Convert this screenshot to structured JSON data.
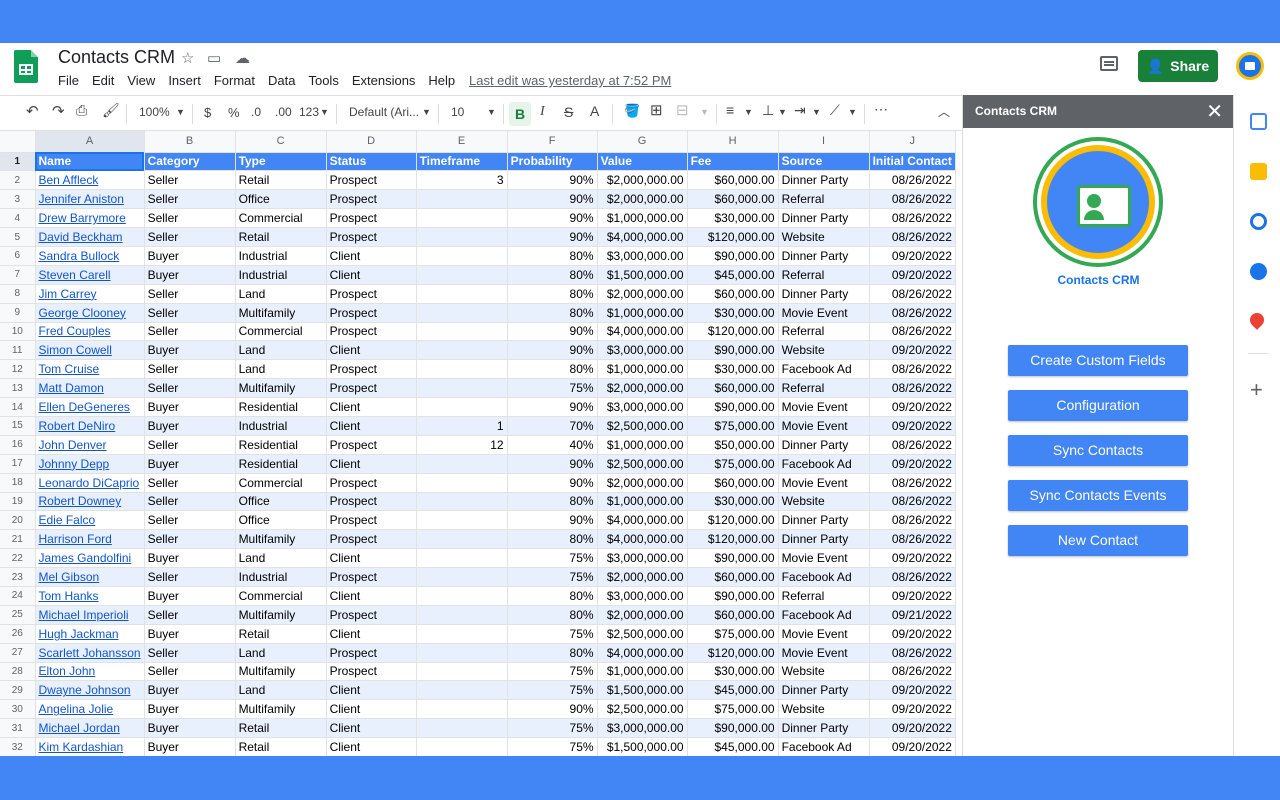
{
  "header": {
    "title": "Contacts CRM",
    "menu": [
      "File",
      "Edit",
      "View",
      "Insert",
      "Format",
      "Data",
      "Tools",
      "Extensions",
      "Help"
    ],
    "last_edit": "Last edit was yesterday at 7:52 PM",
    "share_label": "Share"
  },
  "toolbar": {
    "zoom": "100%",
    "currency": "$",
    "percent": "%",
    "dec_decrease": ".0",
    "dec_increase": ".00",
    "number_format": "123",
    "font": "Default (Ari...",
    "font_size": "10",
    "bold": "B",
    "italic": "I",
    "strike": "S",
    "text_color": "A"
  },
  "grid": {
    "columns": [
      "A",
      "B",
      "C",
      "D",
      "E",
      "F",
      "G",
      "H",
      "I",
      "J"
    ],
    "headers": [
      "Name",
      "Category",
      "Type",
      "Status",
      "Timeframe",
      "Probability",
      "Value",
      "Fee",
      "Source",
      "Initial Contact"
    ],
    "rows": [
      [
        "Ben Affleck",
        "Seller",
        "Retail",
        "Prospect",
        "3",
        "90%",
        "$2,000,000.00",
        "$60,000.00",
        "Dinner Party",
        "08/26/2022"
      ],
      [
        "Jennifer Aniston",
        "Seller",
        "Office",
        "Prospect",
        "",
        "90%",
        "$2,000,000.00",
        "$60,000.00",
        "Referral",
        "08/26/2022"
      ],
      [
        "Drew Barrymore",
        "Seller",
        "Commercial",
        "Prospect",
        "",
        "90%",
        "$1,000,000.00",
        "$30,000.00",
        "Dinner Party",
        "08/26/2022"
      ],
      [
        "David Beckham",
        "Seller",
        "Retail",
        "Prospect",
        "",
        "90%",
        "$4,000,000.00",
        "$120,000.00",
        "Website",
        "08/26/2022"
      ],
      [
        "Sandra Bullock",
        "Buyer",
        "Industrial",
        "Client",
        "",
        "80%",
        "$3,000,000.00",
        "$90,000.00",
        "Dinner Party",
        "09/20/2022"
      ],
      [
        "Steven Carell",
        "Buyer",
        "Industrial",
        "Client",
        "",
        "80%",
        "$1,500,000.00",
        "$45,000.00",
        "Referral",
        "09/20/2022"
      ],
      [
        "Jim Carrey",
        "Seller",
        "Land",
        "Prospect",
        "",
        "80%",
        "$2,000,000.00",
        "$60,000.00",
        "Dinner Party",
        "08/26/2022"
      ],
      [
        "George Clooney",
        "Seller",
        "Multifamily",
        "Prospect",
        "",
        "80%",
        "$1,000,000.00",
        "$30,000.00",
        "Movie Event",
        "08/26/2022"
      ],
      [
        "Fred Couples",
        "Seller",
        "Commercial",
        "Prospect",
        "",
        "90%",
        "$4,000,000.00",
        "$120,000.00",
        "Referral",
        "08/26/2022"
      ],
      [
        "Simon Cowell",
        "Buyer",
        "Land",
        "Client",
        "",
        "90%",
        "$3,000,000.00",
        "$90,000.00",
        "Website",
        "09/20/2022"
      ],
      [
        "Tom Cruise",
        "Seller",
        "Land",
        "Prospect",
        "",
        "80%",
        "$1,000,000.00",
        "$30,000.00",
        "Facebook Ad",
        "08/26/2022"
      ],
      [
        "Matt Damon",
        "Seller",
        "Multifamily",
        "Prospect",
        "",
        "75%",
        "$2,000,000.00",
        "$60,000.00",
        "Referral",
        "08/26/2022"
      ],
      [
        "Ellen DeGeneres",
        "Buyer",
        "Residential",
        "Client",
        "",
        "90%",
        "$3,000,000.00",
        "$90,000.00",
        "Movie Event",
        "09/20/2022"
      ],
      [
        "Robert DeNiro",
        "Buyer",
        "Industrial",
        "Client",
        "1",
        "70%",
        "$2,500,000.00",
        "$75,000.00",
        "Movie Event",
        "09/20/2022"
      ],
      [
        "John Denver",
        "Seller",
        "Residential",
        "Prospect",
        "12",
        "40%",
        "$1,000,000.00",
        "$50,000.00",
        "Dinner Party",
        "08/26/2022"
      ],
      [
        "Johnny Depp",
        "Buyer",
        "Residential",
        "Client",
        "",
        "90%",
        "$2,500,000.00",
        "$75,000.00",
        "Facebook Ad",
        "09/20/2022"
      ],
      [
        "Leonardo DiCaprio",
        "Seller",
        "Commercial",
        "Prospect",
        "",
        "90%",
        "$2,000,000.00",
        "$60,000.00",
        "Movie Event",
        "08/26/2022"
      ],
      [
        "Robert Downey",
        "Seller",
        "Office",
        "Prospect",
        "",
        "80%",
        "$1,000,000.00",
        "$30,000.00",
        "Website",
        "08/26/2022"
      ],
      [
        "Edie Falco",
        "Seller",
        "Office",
        "Prospect",
        "",
        "90%",
        "$4,000,000.00",
        "$120,000.00",
        "Dinner Party",
        "08/26/2022"
      ],
      [
        "Harrison Ford",
        "Seller",
        "Multifamily",
        "Prospect",
        "",
        "80%",
        "$4,000,000.00",
        "$120,000.00",
        "Dinner Party",
        "08/26/2022"
      ],
      [
        "James Gandolfini",
        "Buyer",
        "Land",
        "Client",
        "",
        "75%",
        "$3,000,000.00",
        "$90,000.00",
        "Movie Event",
        "09/20/2022"
      ],
      [
        "Mel Gibson",
        "Seller",
        "Industrial",
        "Prospect",
        "",
        "75%",
        "$2,000,000.00",
        "$60,000.00",
        "Facebook Ad",
        "08/26/2022"
      ],
      [
        "Tom Hanks",
        "Buyer",
        "Commercial",
        "Client",
        "",
        "80%",
        "$3,000,000.00",
        "$90,000.00",
        "Referral",
        "09/20/2022"
      ],
      [
        "Michael Imperioli",
        "Seller",
        "Multifamily",
        "Prospect",
        "",
        "80%",
        "$2,000,000.00",
        "$60,000.00",
        "Facebook Ad",
        "09/21/2022"
      ],
      [
        "Hugh Jackman",
        "Buyer",
        "Retail",
        "Client",
        "",
        "75%",
        "$2,500,000.00",
        "$75,000.00",
        "Movie Event",
        "09/20/2022"
      ],
      [
        "Scarlett Johansson",
        "Seller",
        "Land",
        "Prospect",
        "",
        "80%",
        "$4,000,000.00",
        "$120,000.00",
        "Movie Event",
        "08/26/2022"
      ],
      [
        "Elton John",
        "Seller",
        "Multifamily",
        "Prospect",
        "",
        "75%",
        "$1,000,000.00",
        "$30,000.00",
        "Website",
        "08/26/2022"
      ],
      [
        "Dwayne Johnson",
        "Buyer",
        "Land",
        "Client",
        "",
        "75%",
        "$1,500,000.00",
        "$45,000.00",
        "Dinner Party",
        "09/20/2022"
      ],
      [
        "Angelina Jolie",
        "Buyer",
        "Multifamily",
        "Client",
        "",
        "90%",
        "$2,500,000.00",
        "$75,000.00",
        "Website",
        "09/20/2022"
      ],
      [
        "Michael Jordan",
        "Buyer",
        "Retail",
        "Client",
        "",
        "75%",
        "$3,000,000.00",
        "$90,000.00",
        "Dinner Party",
        "09/20/2022"
      ],
      [
        "Kim Kardashian",
        "Buyer",
        "Retail",
        "Client",
        "",
        "75%",
        "$1,500,000.00",
        "$45,000.00",
        "Facebook Ad",
        "09/20/2022"
      ]
    ]
  },
  "panel": {
    "header": "Contacts CRM",
    "title": "Contacts CRM",
    "buttons": [
      "Create Custom Fields",
      "Configuration",
      "Sync Contacts",
      "Sync Contacts Events",
      "New Contact"
    ]
  },
  "colors": {
    "accent": "#4285f4",
    "header_row": "#4285f4",
    "alt_row": "#e8f0fe",
    "share": "#188038",
    "panel_header": "#5f6368"
  }
}
